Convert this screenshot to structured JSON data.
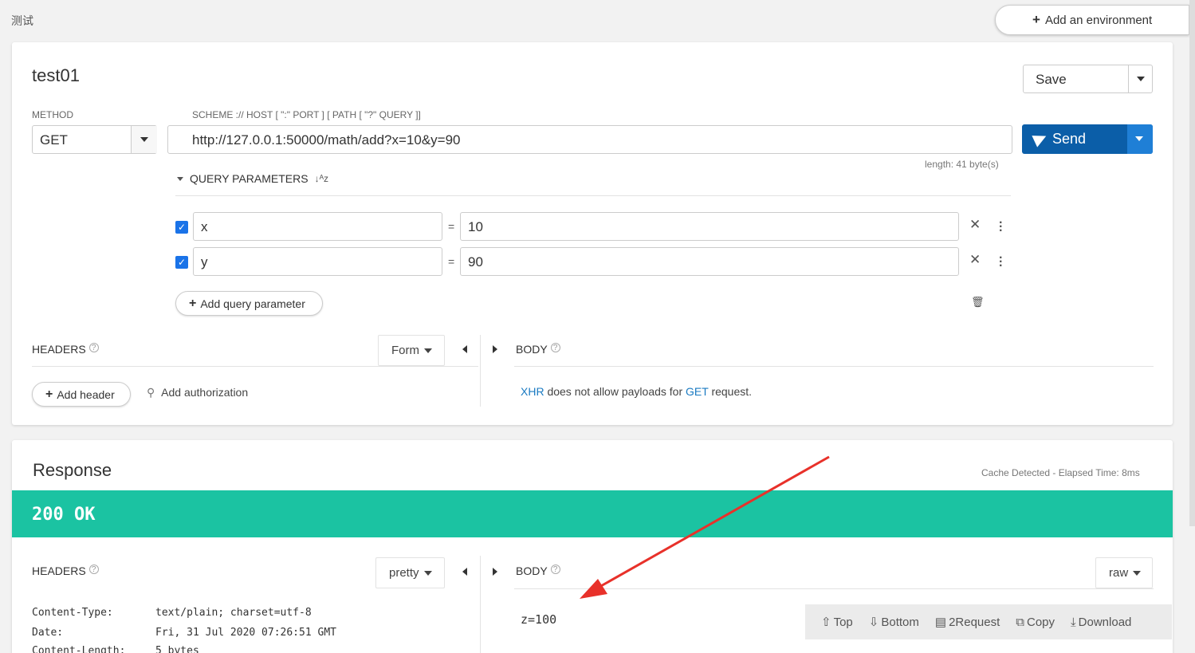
{
  "breadcrumb": "测试",
  "add_environment": "Add an environment",
  "request": {
    "name": "test01",
    "save_label": "Save",
    "method_label": "METHOD",
    "method": "GET",
    "scheme_label": "SCHEME :// HOST [ \":\" PORT ] [ PATH [ \"?\" QUERY ]]",
    "url": "http://127.0.0.1:50000/math/add?x=10&y=90",
    "send_label": "Send",
    "length": "length: 41 byte(s)",
    "query_title": "QUERY PARAMETERS",
    "params": [
      {
        "name": "x",
        "value": "10"
      },
      {
        "name": "y",
        "value": "90"
      }
    ],
    "add_query": "Add query parameter",
    "headers_title": "HEADERS",
    "headers_mode": "Form",
    "add_header": "Add header",
    "add_auth": "Add authorization",
    "body_title": "BODY",
    "body_msg": {
      "xhr": "XHR",
      "mid": "does not allow payloads for",
      "get": "GET",
      "end": "request."
    }
  },
  "response": {
    "title": "Response",
    "elapsed": "Cache Detected - Elapsed Time: 8ms",
    "status": "200 OK",
    "headers_title": "HEADERS",
    "headers_mode": "pretty",
    "headers": [
      {
        "k": "Content-Type:",
        "v": "text/plain; charset=utf-8"
      },
      {
        "k": "Date:",
        "v": "Fri, 31 Jul 2020 07:26:51 GMT"
      },
      {
        "k": "Content-Length:",
        "v": "5 bytes"
      }
    ],
    "body_title": "BODY",
    "body_mode": "raw",
    "body": "z=100",
    "toolbar": {
      "top": "Top",
      "bottom": "Bottom",
      "to_request": "2Request",
      "copy": "Copy",
      "download": "Download"
    }
  },
  "colors": {
    "accent": "#0b5ea8",
    "status_ok": "#1bc3a2",
    "annotation": "#e8312a"
  }
}
